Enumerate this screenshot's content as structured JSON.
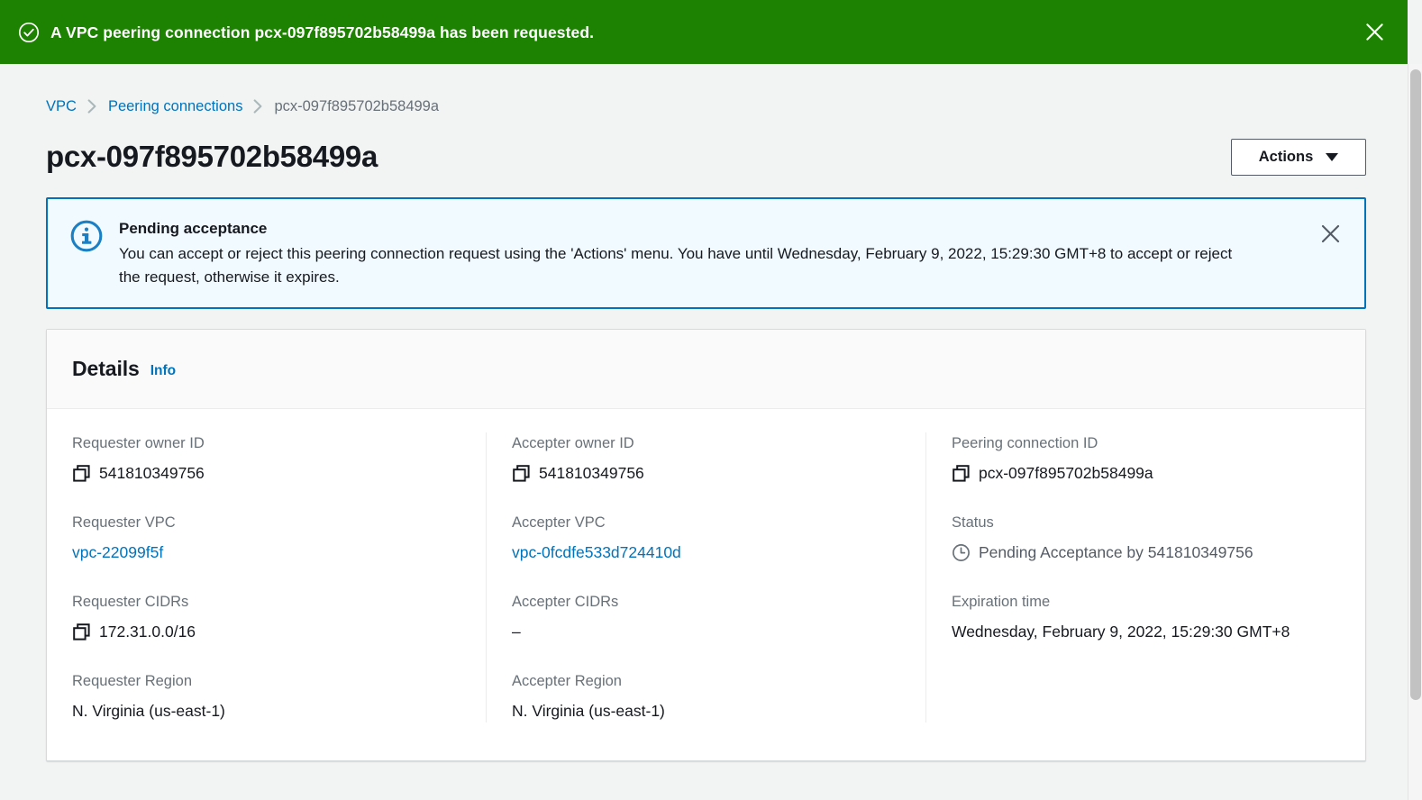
{
  "flash": {
    "message": "A VPC peering connection pcx-097f895702b58499a has been requested.",
    "icon": "success-check-icon",
    "close_icon": "close-icon",
    "background_color": "#1d8102",
    "text_color": "#ffffff"
  },
  "breadcrumb": {
    "items": [
      {
        "label": "VPC",
        "is_link": true
      },
      {
        "label": "Peering connections",
        "is_link": true
      },
      {
        "label": "pcx-097f895702b58499a",
        "is_link": false
      }
    ],
    "separator": "›",
    "link_color": "#0073bb",
    "current_color": "#687078"
  },
  "header": {
    "title": "pcx-097f895702b58499a",
    "actions_button_label": "Actions"
  },
  "alert": {
    "icon": "info-circle-icon",
    "title": "Pending acceptance",
    "text": "You can accept or reject this peering connection request using the 'Actions' menu. You have until Wednesday, February 9, 2022, 15:29:30 GMT+8 to accept or reject the request, otherwise it expires.",
    "close_icon": "close-icon",
    "border_color": "#0073bb",
    "background_color": "#f1faff"
  },
  "details": {
    "title": "Details",
    "info_label": "Info",
    "columns": [
      {
        "fields": [
          {
            "label": "Requester owner ID",
            "value": "541810349756",
            "type": "copyable",
            "icon": "copy-icon"
          },
          {
            "label": "Requester VPC",
            "value": "vpc-22099f5f",
            "type": "link"
          },
          {
            "label": "Requester CIDRs",
            "value": "172.31.0.0/16",
            "type": "copyable",
            "icon": "copy-icon"
          },
          {
            "label": "Requester Region",
            "value": "N. Virginia (us-east-1)",
            "type": "text"
          }
        ]
      },
      {
        "fields": [
          {
            "label": "Accepter owner ID",
            "value": "541810349756",
            "type": "copyable",
            "icon": "copy-icon"
          },
          {
            "label": "Accepter VPC",
            "value": "vpc-0fcdfe533d724410d",
            "type": "link"
          },
          {
            "label": "Accepter CIDRs",
            "value": "–",
            "type": "text"
          },
          {
            "label": "Accepter Region",
            "value": "N. Virginia (us-east-1)",
            "type": "text"
          }
        ]
      },
      {
        "fields": [
          {
            "label": "Peering connection ID",
            "value": "pcx-097f895702b58499a",
            "type": "copyable",
            "icon": "copy-icon"
          },
          {
            "label": "Status",
            "value": "Pending Acceptance by 541810349756",
            "type": "status",
            "icon": "clock-pending-icon"
          },
          {
            "label": "Expiration time",
            "value": "Wednesday, February 9, 2022, 15:29:30 GMT+8",
            "type": "text"
          }
        ]
      }
    ]
  },
  "scrollbar": {
    "name": "vertical-scrollbar"
  }
}
